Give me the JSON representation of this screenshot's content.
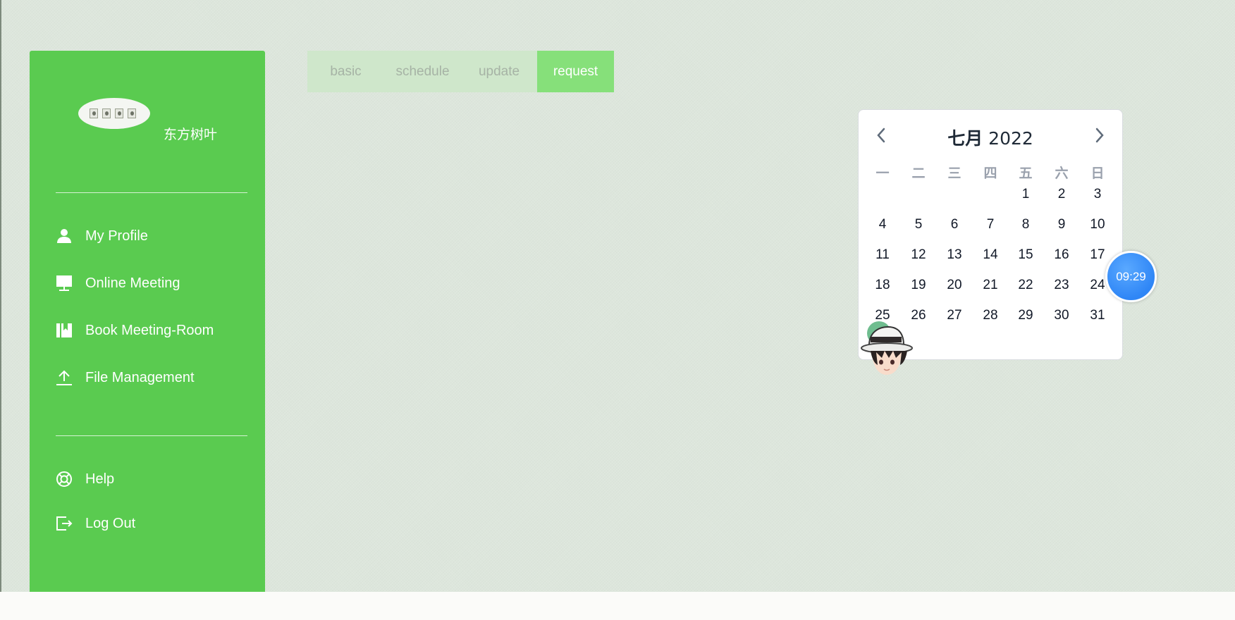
{
  "sidebar": {
    "username": "东方树叶",
    "nav_items": [
      {
        "label": "My Profile",
        "icon": "user-icon"
      },
      {
        "label": "Online Meeting",
        "icon": "monitor-icon"
      },
      {
        "label": "Book Meeting-Room",
        "icon": "book-icon"
      },
      {
        "label": "File Management",
        "icon": "upload-icon"
      }
    ],
    "footer_items": [
      {
        "label": "Help",
        "icon": "lifebuoy-icon"
      },
      {
        "label": "Log Out",
        "icon": "logout-icon"
      }
    ]
  },
  "tabs": [
    {
      "label": "basic",
      "active": false
    },
    {
      "label": "schedule",
      "active": false
    },
    {
      "label": "update",
      "active": false
    },
    {
      "label": "request",
      "active": true
    }
  ],
  "calendar": {
    "month": "七月",
    "year": "2022",
    "weekdays": [
      "一",
      "二",
      "三",
      "四",
      "五",
      "六",
      "日"
    ],
    "first_weekday_index": 4,
    "days_in_month": 31
  },
  "clock": {
    "time": "09:29"
  },
  "colors": {
    "sidebar": "#5acb50",
    "tab_active": "#86e07a",
    "tab_inactive": "#cfe7cb",
    "clock_bubble": "#2f86f6",
    "background": "#dde6dc"
  }
}
